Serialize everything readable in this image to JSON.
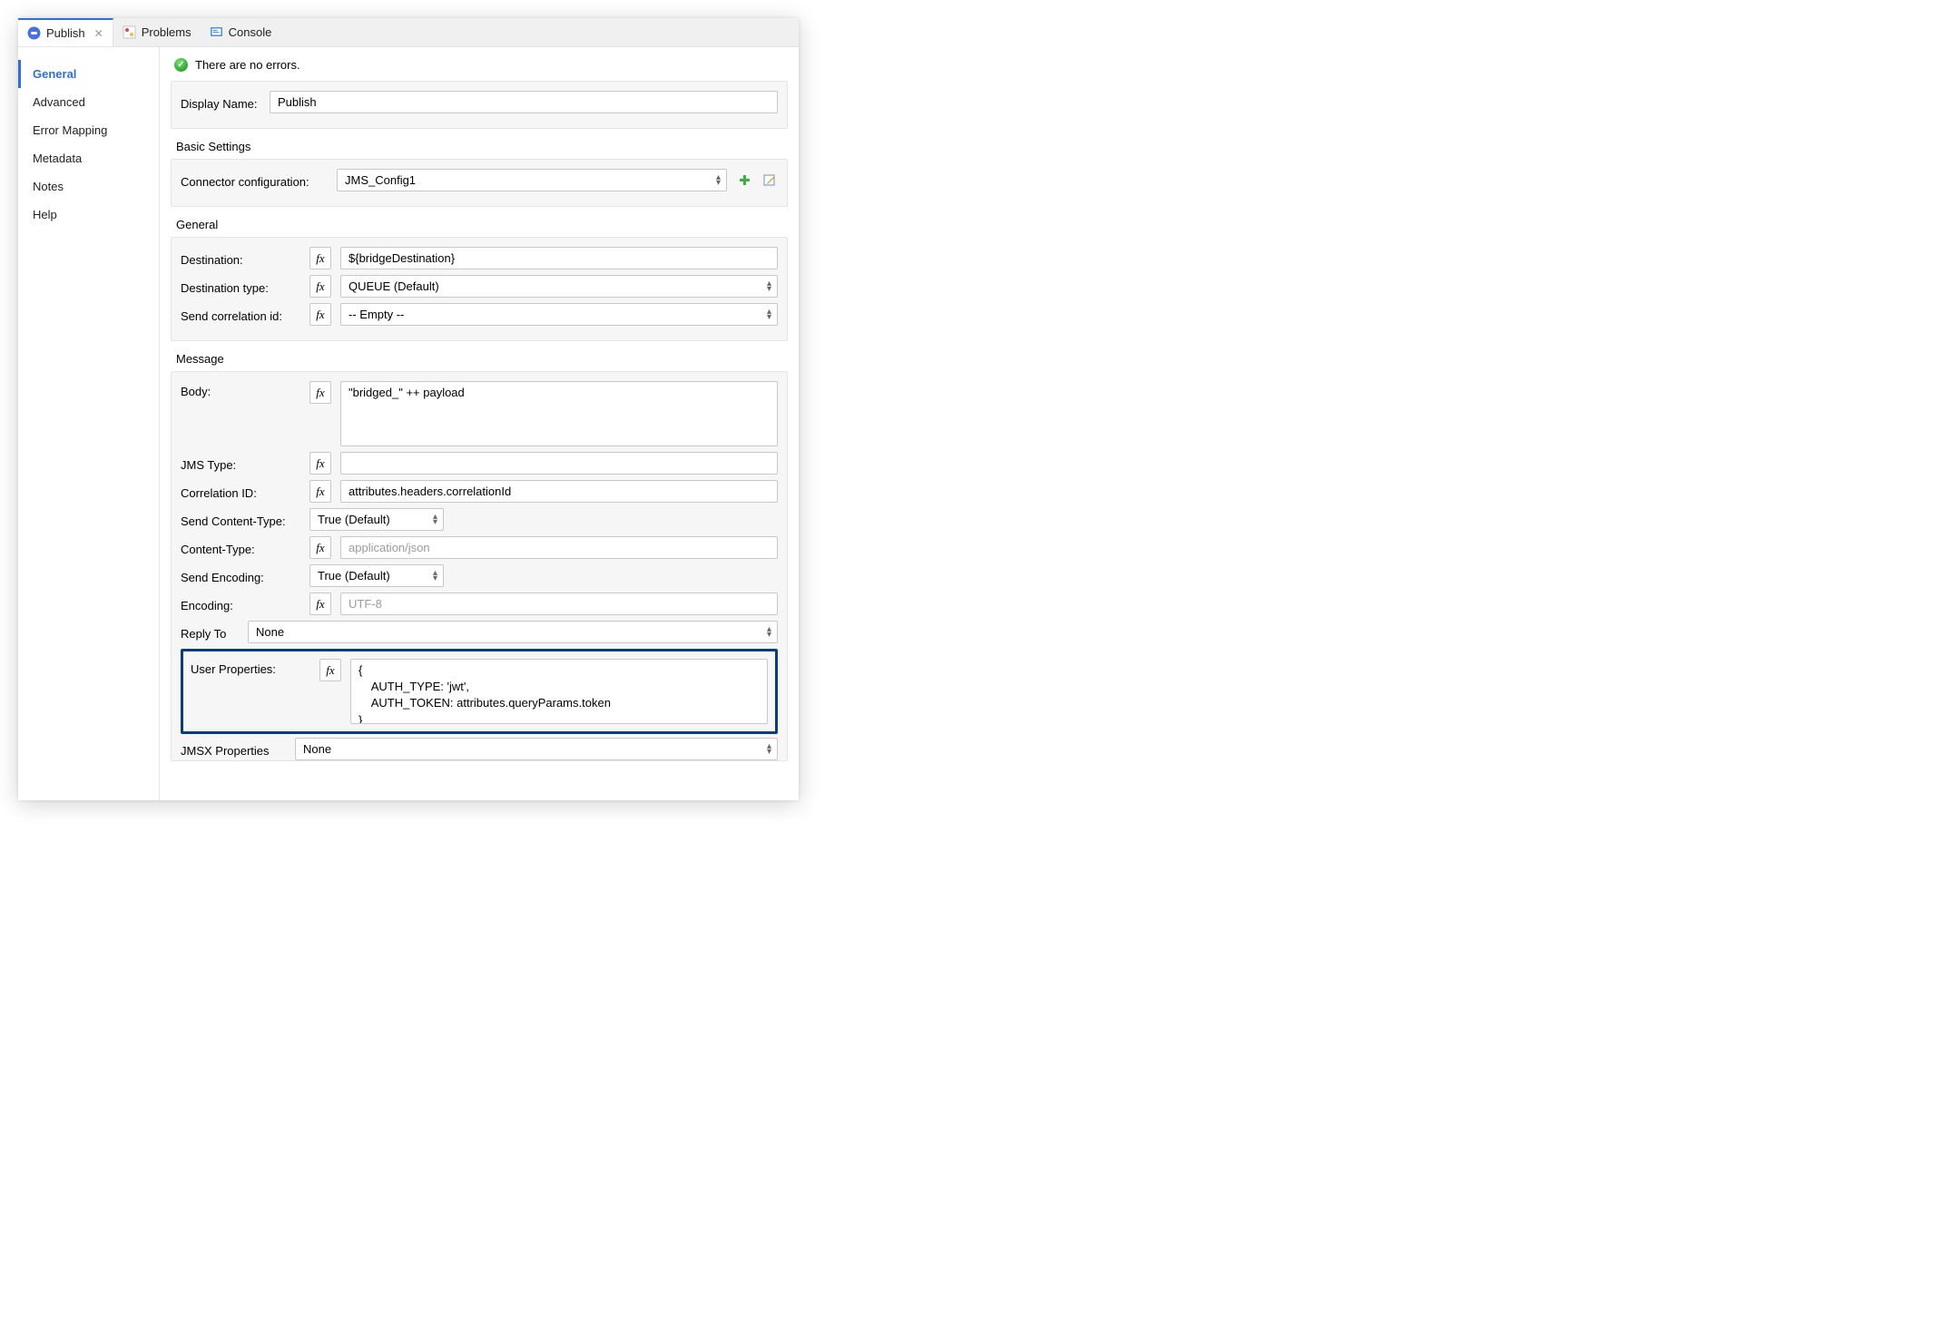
{
  "tabs": {
    "publish": {
      "label": "Publish"
    },
    "problems": {
      "label": "Problems"
    },
    "console": {
      "label": "Console"
    }
  },
  "sidebar": {
    "items": [
      {
        "label": "General"
      },
      {
        "label": "Advanced"
      },
      {
        "label": "Error Mapping"
      },
      {
        "label": "Metadata"
      },
      {
        "label": "Notes"
      },
      {
        "label": "Help"
      }
    ]
  },
  "status": {
    "message": "There are no errors."
  },
  "displayName": {
    "label": "Display Name:",
    "value": "Publish"
  },
  "basicSettings": {
    "title": "Basic Settings",
    "connectorConfigLabel": "Connector configuration:",
    "connectorConfigValue": "JMS_Config1"
  },
  "general": {
    "title": "General",
    "destinationLabel": "Destination:",
    "destinationValue": "${bridgeDestination}",
    "destinationTypeLabel": "Destination type:",
    "destinationTypeValue": "QUEUE (Default)",
    "sendCorrelationLabel": "Send correlation id:",
    "sendCorrelationValue": "-- Empty --"
  },
  "message": {
    "title": "Message",
    "bodyLabel": "Body:",
    "bodyValue": "\"bridged_\" ++ payload",
    "jmsTypeLabel": "JMS Type:",
    "jmsTypeValue": "",
    "correlationIdLabel": "Correlation ID:",
    "correlationIdValue": "attributes.headers.correlationId",
    "sendContentTypeLabel": "Send Content-Type:",
    "sendContentTypeValue": "True (Default)",
    "contentTypeLabel": "Content-Type:",
    "contentTypePlaceholder": "application/json",
    "sendEncodingLabel": "Send Encoding:",
    "sendEncodingValue": "True (Default)",
    "encodingLabel": "Encoding:",
    "encodingPlaceholder": "UTF-8",
    "replyToLabel": "Reply To",
    "replyToValue": "None",
    "userPropsLabel": "User Properties:",
    "userPropsValue": "{\n    AUTH_TYPE: 'jwt',\n    AUTH_TOKEN: attributes.queryParams.token\n}",
    "jmsxPropsLabel": "JMSX Properties",
    "jmsxPropsValue": "None"
  }
}
